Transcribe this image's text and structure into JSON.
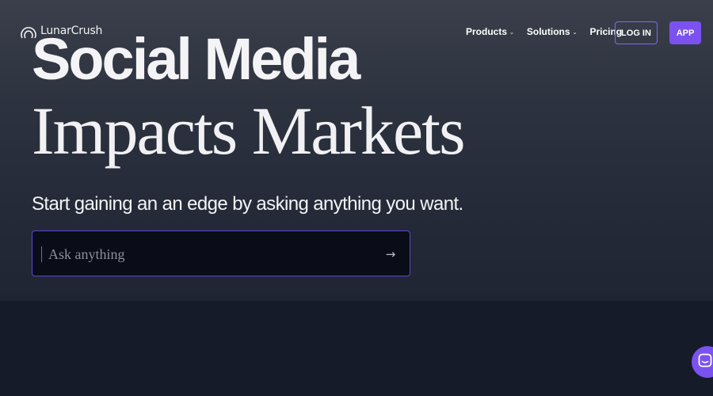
{
  "nav": {
    "logo_text": "LunarCrush",
    "logo_icon": "lunarcrush-logo-icon",
    "links": [
      {
        "label": "Products",
        "has_dropdown": true
      },
      {
        "label": "Solutions",
        "has_dropdown": true
      },
      {
        "label": "Pricing",
        "has_dropdown": false
      }
    ],
    "login_label": "LOG IN",
    "app_label": "APP"
  },
  "hero": {
    "headline_line1": "Social Media",
    "headline_line2": "Impacts Markets",
    "subtitle": "Start gaining an an edge by asking anything you want.",
    "ask": {
      "placeholder": "Ask anything",
      "value": "",
      "submit_icon": "arrow-right-icon"
    }
  },
  "chat_launcher": {
    "icon": "chat-bubble-icon"
  },
  "colors": {
    "accent": "#7b52f0",
    "login_border": "#7a6cf0",
    "hero_bg": "#2d323f",
    "page_bg": "#161b2a"
  }
}
